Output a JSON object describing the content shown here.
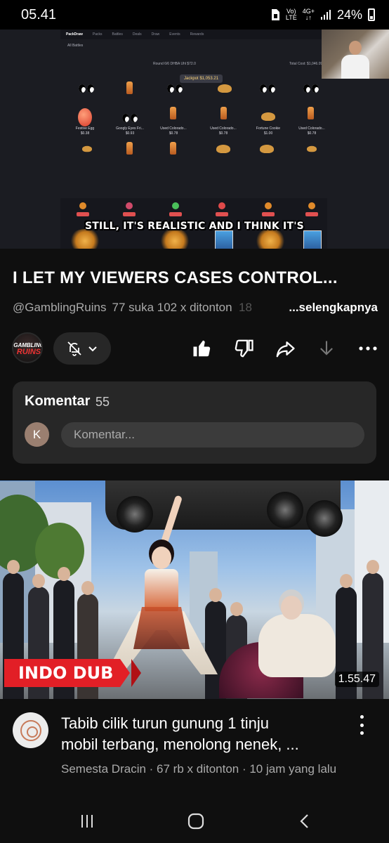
{
  "status_bar": {
    "time": "05.41",
    "volte": "Vo)",
    "lte": "LTE",
    "network": "4G+",
    "battery": "24%"
  },
  "video": {
    "caption": "STILL, IT'S REALISTIC AND I THINK IT'S",
    "progress": 0.155,
    "embedded": {
      "brand": "PackDraw",
      "nav": [
        "Packs",
        "Battles",
        "Deals",
        "Draw",
        "Events",
        "Rewards"
      ],
      "back": "All Battles",
      "jackpot_label": "Jackpot $1,053.21",
      "round_text": "Round 6/6   DHBA Uhl   $72.0",
      "total_cost": "Total Cost: $1,046.09",
      "items": [
        {
          "name": "Festive Egg",
          "price": "$0.38"
        },
        {
          "name": "Googly Eyes Fri...",
          "price": "$0.93"
        },
        {
          "name": "Used Colorado...",
          "price": "$0.78"
        },
        {
          "name": "Used Colorado...",
          "price": "$0.78"
        },
        {
          "name": "Fortune Cookie",
          "price": "$1.00"
        },
        {
          "name": "Used Colorado...",
          "price": "$0.78"
        }
      ]
    }
  },
  "title": "I LET MY VIEWERS CASES CONTROL...",
  "meta": {
    "channel": "@GamblingRuins",
    "likes": "77 suka",
    "views": "102 x ditonton",
    "extra": "18",
    "more": "...selengkapnya"
  },
  "channel_avatar": {
    "line1": "GAMBLING",
    "line2": "RUINS"
  },
  "comments": {
    "label": "Komentar",
    "count": "55",
    "user_initial": "K",
    "placeholder": "Komentar..."
  },
  "next_video": {
    "badge": "INDO DUB",
    "duration": "1.55.47",
    "title_line1": "Tabib cilik turun gunung 1 tinju",
    "title_line2": "mobil terbang, menolong nenek, ...",
    "meta": "Semesta Dracin · 67 rb x ditonton · 10 jam yang lalu"
  },
  "icons": {
    "bell": "bell-off-icon",
    "like": "thumbs-up-icon",
    "dislike": "thumbs-down-icon",
    "share": "share-icon",
    "download": "download-icon",
    "more": "more-horizontal-icon"
  },
  "colors": {
    "background": "#0f0f0f",
    "card": "#272727",
    "accent_red": "#e21f26",
    "secondary_text": "#aaaaaa"
  }
}
